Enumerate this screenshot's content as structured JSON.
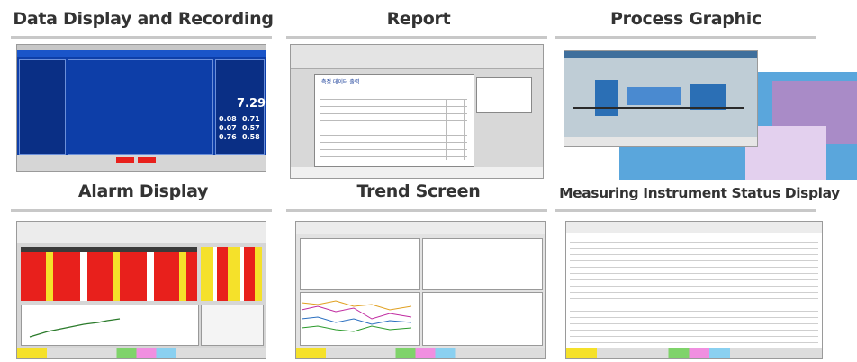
{
  "panels": {
    "p1": {
      "title": "Data Display and Recording",
      "big_value": "7.29",
      "big_values": [
        "0.08",
        "0.71",
        "0.07",
        "0.57",
        "0.76",
        "0.58"
      ]
    },
    "p2": {
      "title": "Report",
      "report_heading": "측정 데이터 출력"
    },
    "p3": {
      "title": "Process Graphic"
    },
    "p4": {
      "title": "Alarm Display"
    },
    "p5": {
      "title": "Trend Screen"
    },
    "p6": {
      "title": "Measuring Instrument Status Display"
    }
  },
  "colors": {
    "title_text": "#333333",
    "rule": "#c8c8c8",
    "dashboard_blue": "#0d3ea8",
    "alarm_red": "#e8201c",
    "alarm_yellow": "#f5e12a",
    "map_purple": "#a98bc7",
    "water_blue": "#5aa6dc"
  }
}
